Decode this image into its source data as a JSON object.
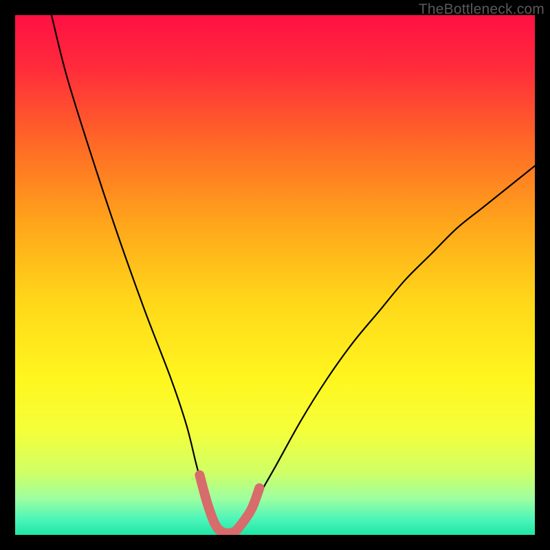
{
  "watermark": "TheBottleneck.com",
  "chart_data": {
    "type": "line",
    "title": "",
    "xlabel": "",
    "ylabel": "",
    "xlim": [
      0,
      100
    ],
    "ylim": [
      0,
      100
    ],
    "grid": false,
    "legend": false,
    "series": [
      {
        "name": "bottleneck-curve",
        "x": [
          7,
          10,
          15,
          20,
          25,
          30,
          33,
          35,
          37,
          38.5,
          40,
          42,
          44,
          46,
          50,
          55,
          60,
          65,
          70,
          75,
          80,
          85,
          90,
          95,
          100
        ],
        "y": [
          100,
          88,
          72,
          57,
          43,
          30,
          21,
          13,
          6,
          2,
          0.5,
          0.5,
          2,
          6,
          13,
          22,
          30,
          37,
          43,
          49,
          54,
          59,
          63,
          67,
          71
        ]
      }
    ],
    "annotations": [
      {
        "name": "valley-highlight",
        "type": "curve-segment",
        "color": "#d86b6b",
        "x": [
          35.5,
          37,
          38.5,
          40,
          42,
          43.5,
          45.5,
          47
        ],
        "y": [
          11.5,
          6,
          2,
          0.5,
          0.5,
          2,
          5,
          9
        ]
      }
    ],
    "background_gradient": {
      "stops": [
        {
          "offset": 0.0,
          "color": "#ff1043"
        },
        {
          "offset": 0.1,
          "color": "#ff2b3b"
        },
        {
          "offset": 0.25,
          "color": "#ff6a26"
        },
        {
          "offset": 0.4,
          "color": "#ffa51b"
        },
        {
          "offset": 0.55,
          "color": "#ffd71a"
        },
        {
          "offset": 0.7,
          "color": "#fff61f"
        },
        {
          "offset": 0.8,
          "color": "#f4ff3a"
        },
        {
          "offset": 0.88,
          "color": "#d0ff66"
        },
        {
          "offset": 0.93,
          "color": "#9effa0"
        },
        {
          "offset": 0.97,
          "color": "#4cf5b9"
        },
        {
          "offset": 1.0,
          "color": "#1fe6a4"
        }
      ]
    }
  }
}
